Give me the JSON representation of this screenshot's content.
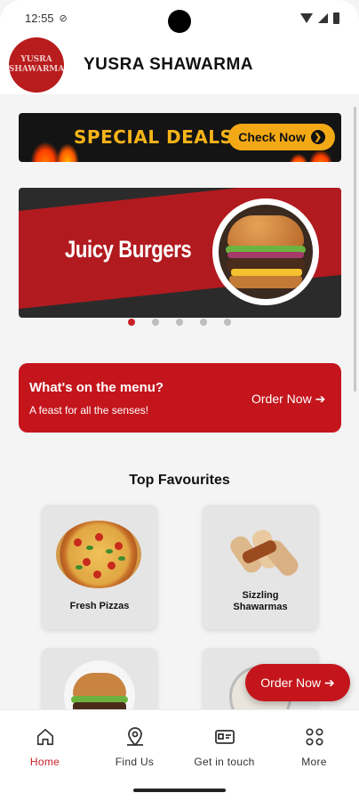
{
  "status_bar": {
    "time": "12:55"
  },
  "header": {
    "logo_text": "YUSRA SHAWARMA",
    "title": "YUSRA SHAWARMA"
  },
  "deals_banner": {
    "title": "SPECIAL DEALS",
    "button_label": "Check Now"
  },
  "carousel": {
    "slide_title": "Juicy Burgers",
    "slide_count": 5,
    "active_index": 0
  },
  "menu_card": {
    "title": "What's on the menu?",
    "subtitle": "A feast for all the senses!",
    "action_label": "Order Now"
  },
  "favourites": {
    "title": "Top Favourites",
    "items": [
      {
        "label": "Fresh Pizzas"
      },
      {
        "label": "Sizzling Shawarmas"
      }
    ]
  },
  "floating_button": {
    "label": "Order Now"
  },
  "bottom_nav": {
    "items": [
      {
        "label": "Home",
        "icon": "home-icon",
        "active": true
      },
      {
        "label": "Find Us",
        "icon": "map-pin-icon",
        "active": false
      },
      {
        "label": "Get in touch",
        "icon": "contact-card-icon",
        "active": false
      },
      {
        "label": "More",
        "icon": "grid-icon",
        "active": false
      }
    ]
  },
  "colors": {
    "brand_red": "#c4151c",
    "accent_yellow": "#f3a915",
    "active_nav": "#c62026"
  }
}
